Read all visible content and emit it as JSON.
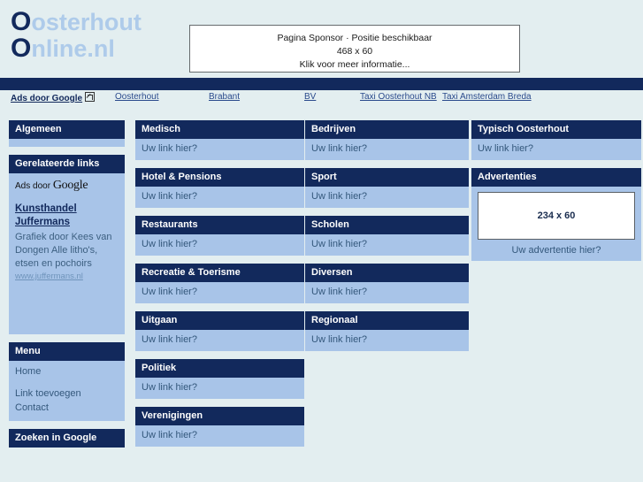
{
  "site": {
    "logo_line1_cap": "O",
    "logo_line1_rest": "osterhout",
    "logo_line2_cap": "O",
    "logo_line2_rest": "nline.nl"
  },
  "sponsor": {
    "line1": "Pagina Sponsor · Positie beschikbaar",
    "line2": "468 x 60",
    "line3": "Klik voor meer informatie..."
  },
  "ads_bar": {
    "label": "Ads door Google",
    "links": [
      "Oosterhout",
      "Brabant",
      "BV",
      "Taxi Oosterhout NB",
      "Taxi Amsterdam Breda"
    ]
  },
  "sidebar": {
    "algemeen": {
      "title": "Algemeen"
    },
    "related": {
      "title": "Gerelateerde links",
      "ads_label_prefix": "Ads door ",
      "ads_label_google": "Google",
      "ad_title_line1": "Kunsthandel",
      "ad_title_line2": "Juffermans",
      "ad_desc": "Grafiek door Kees van Dongen Alle litho's, etsen en pochoirs",
      "ad_url": "www.juffermans.nl"
    },
    "menu": {
      "title": "Menu",
      "items": [
        "Home",
        "Link toevoegen",
        "Contact"
      ]
    },
    "search": {
      "title": "Zoeken in Google"
    }
  },
  "columns": {
    "col1": [
      {
        "title": "Medisch",
        "link": "Uw link hier?"
      },
      {
        "title": "Hotel & Pensions",
        "link": "Uw link hier?"
      },
      {
        "title": "Restaurants",
        "link": "Uw link hier?"
      },
      {
        "title": "Recreatie & Toerisme",
        "link": "Uw link hier?"
      },
      {
        "title": "Uitgaan",
        "link": "Uw link hier?"
      },
      {
        "title": "Politiek",
        "link": "Uw link hier?"
      },
      {
        "title": "Verenigingen",
        "link": "Uw link hier?"
      }
    ],
    "col2": [
      {
        "title": "Bedrijven",
        "link": "Uw link hier?"
      },
      {
        "title": "Sport",
        "link": "Uw link hier?"
      },
      {
        "title": "Scholen",
        "link": "Uw link hier?"
      },
      {
        "title": "Diversen",
        "link": "Uw link hier?"
      },
      {
        "title": "Regionaal",
        "link": "Uw link hier?"
      }
    ],
    "col3": [
      {
        "title": "Typisch Oosterhout",
        "link": "Uw link hier?"
      }
    ],
    "advertenties": {
      "title": "Advertenties",
      "banner_size": "234 x 60",
      "caption": "Uw advertentie hier?"
    }
  },
  "colors": {
    "navy": "#12295c",
    "light_blue": "#a8c4e8",
    "page_bg": "#e3eef0",
    "logo_light": "#aecbea"
  }
}
